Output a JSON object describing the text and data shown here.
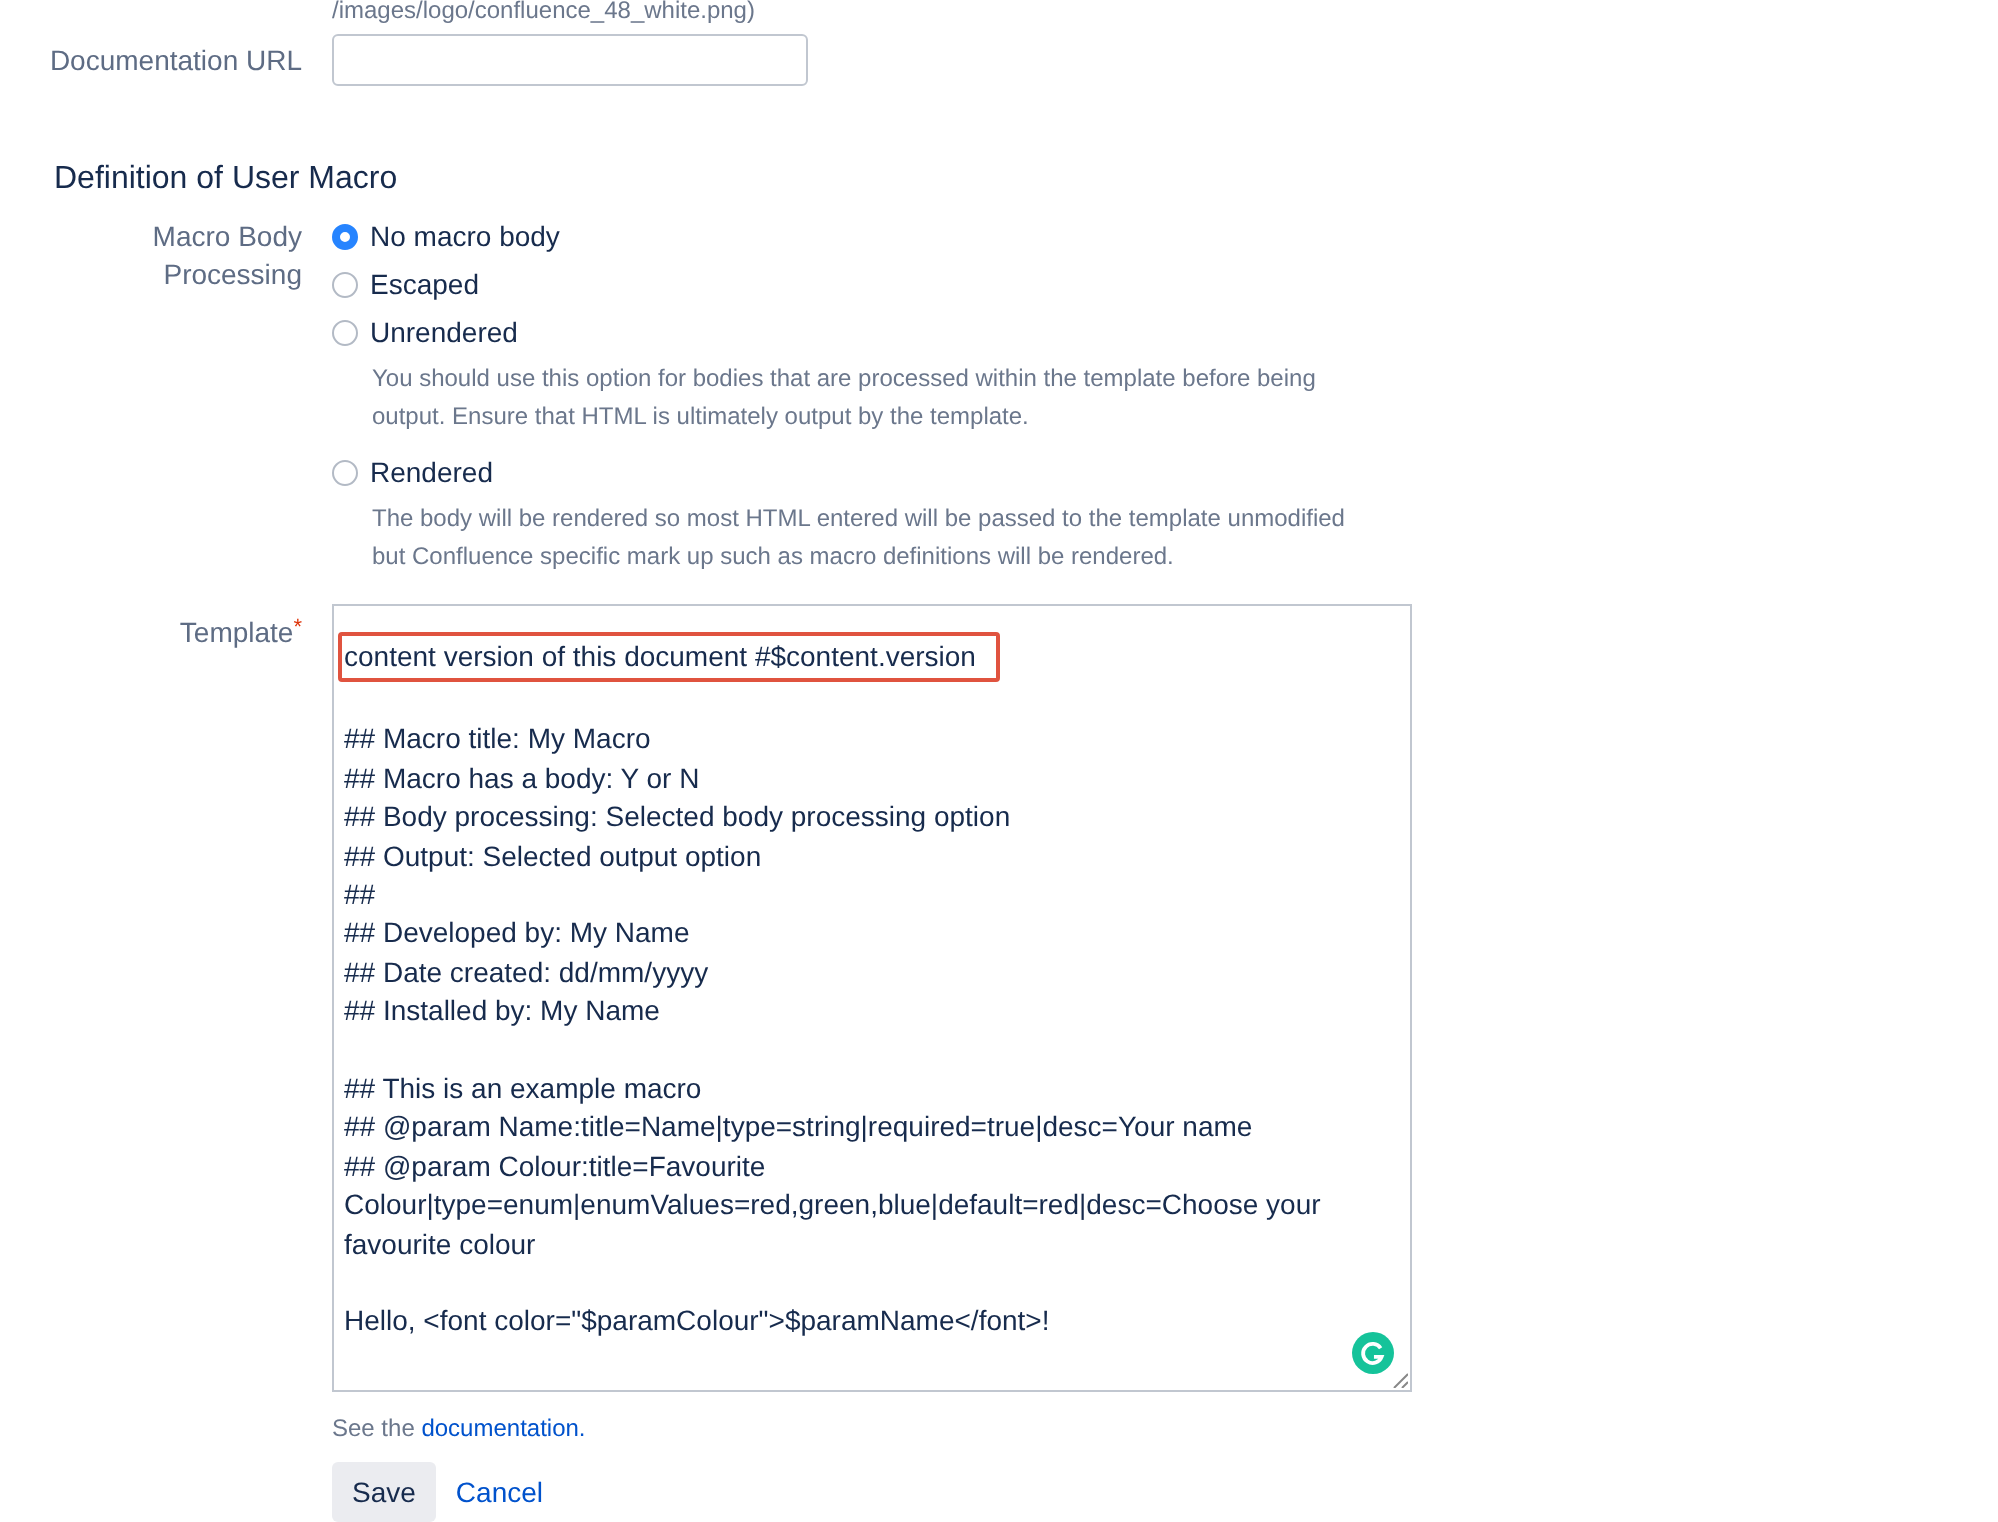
{
  "cut_text": "/images/logo/confluence_48_white.png)",
  "documentation_url": {
    "label": "Documentation URL"
  },
  "section": {
    "title": "Definition of User Macro"
  },
  "body_processing": {
    "label_lines": [
      "Macro Body",
      "Processing"
    ],
    "options": [
      {
        "label": "No macro body",
        "selected": true
      },
      {
        "label": "Escaped",
        "selected": false
      },
      {
        "label": "Unrendered",
        "selected": false,
        "description": "You should use this option for bodies that are processed within the template before being output. Ensure that HTML is ultimately output by the template."
      },
      {
        "label": "Rendered",
        "selected": false,
        "description": "The body will be rendered so most HTML entered will be passed to the template unmodified but Confluence specific mark up such as macro definitions will be rendered."
      }
    ]
  },
  "template": {
    "label": "Template",
    "required_mark": "*",
    "paragraphs": [
      {
        "highlighted": true,
        "lines": [
          "content version of this document #$content.version"
        ]
      },
      {
        "highlighted": false,
        "lines": [
          "## Macro title: My Macro",
          "## Macro has a body: Y or N",
          "## Body processing: Selected body processing option",
          "## Output: Selected output option",
          "##",
          "## Developed by: My Name",
          "## Date created: dd/mm/yyyy",
          "## Installed by: My Name"
        ]
      },
      {
        "highlighted": false,
        "lines": [
          "## This is an example macro",
          "## @param Name:title=Name|type=string|required=true|desc=Your name",
          "## @param Colour:title=Favourite Colour|type=enum|enumValues=red,green,blue|default=red|desc=Choose your favourite colour"
        ]
      },
      {
        "highlighted": false,
        "lines": [
          "Hello, <font color=\"$paramColour\">$paramName</font>!"
        ]
      }
    ]
  },
  "help": {
    "text": "See the",
    "link": "documentation."
  },
  "buttons": {
    "save": "Save",
    "cancel": "Cancel"
  }
}
